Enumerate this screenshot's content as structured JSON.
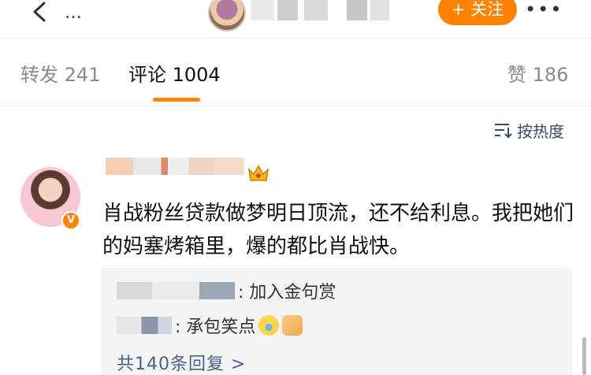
{
  "header": {
    "back_icon": "chevron-left-icon",
    "more_left": "…",
    "follow_label": "+ 关注",
    "more_right": "•••"
  },
  "tabs": [
    {
      "label": "转发 241"
    },
    {
      "label": "评论 1004"
    },
    {
      "label": "赞 186"
    }
  ],
  "sort": {
    "label": "按热度",
    "icon": "sort-icon"
  },
  "comment": {
    "text": "肖战粉丝贷款做梦明日顶流，还不给利息。我把她们的妈塞烤箱里，爆的都比肖战快。",
    "badge": "V"
  },
  "replies": [
    {
      "text": ": 加入金句赏"
    },
    {
      "text": ": 承包笑点"
    }
  ],
  "reply_link": "共140条回复 >",
  "colors": {
    "accent": "#ff8200",
    "link": "#4a5f8a"
  }
}
